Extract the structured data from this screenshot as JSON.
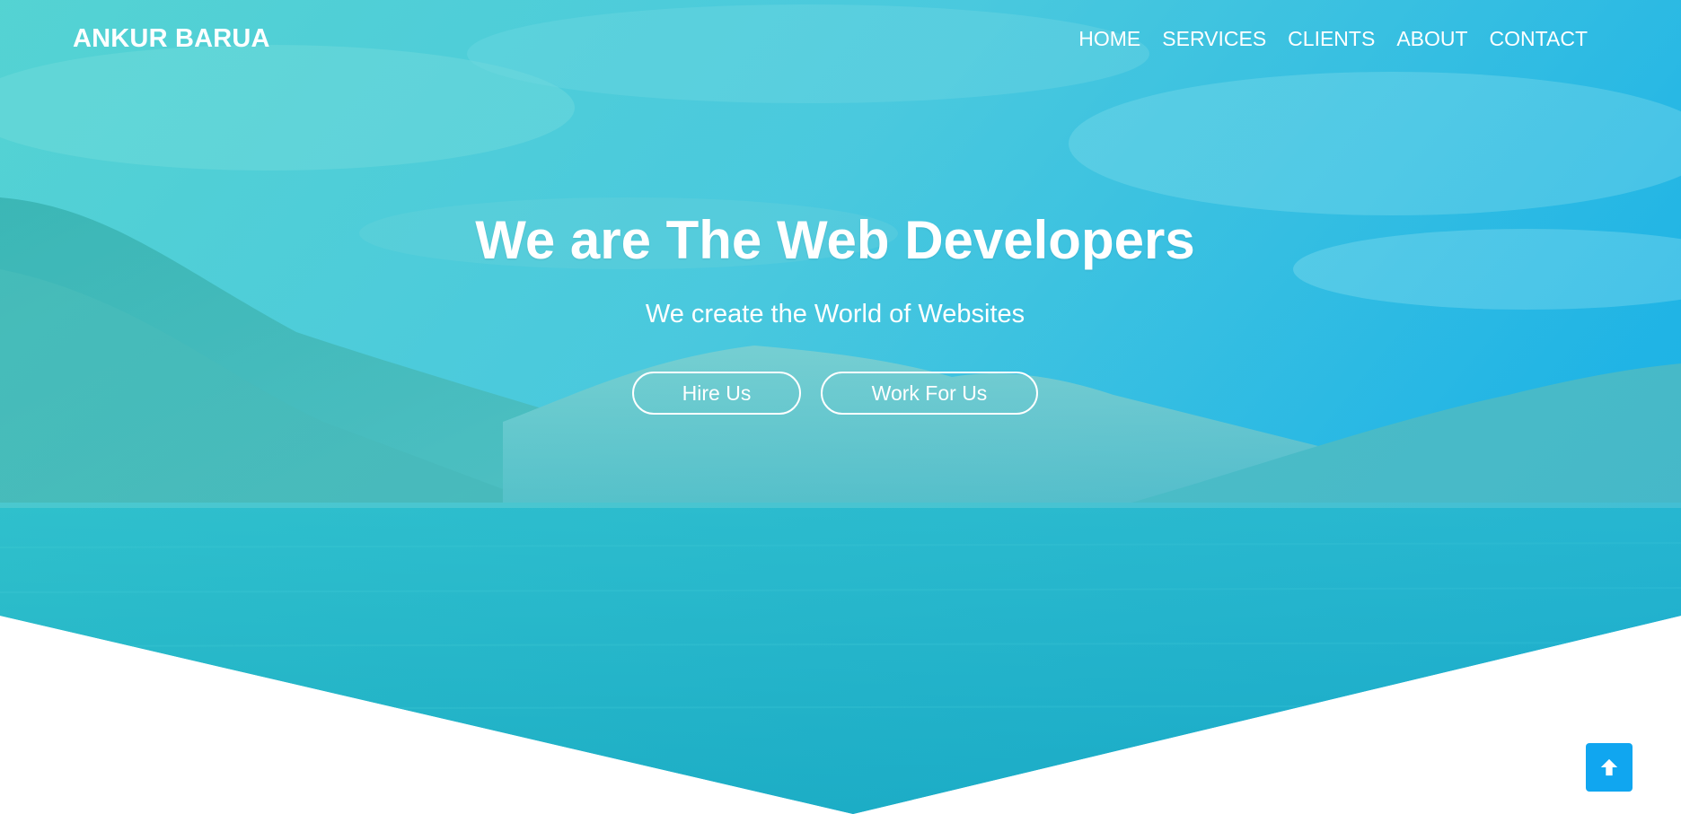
{
  "brand": {
    "name": "ANKUR BARUA"
  },
  "nav": {
    "items": [
      {
        "label": "HOME"
      },
      {
        "label": "SERVICES"
      },
      {
        "label": "CLIENTS"
      },
      {
        "label": "ABOUT"
      },
      {
        "label": "CONTACT"
      }
    ]
  },
  "hero": {
    "headline": "We are The Web Developers",
    "subheadline": "We create the World of Websites",
    "primary_button": "Hire Us",
    "secondary_button": "Work For Us",
    "overlay_color": "#3fc9d8",
    "background_subject": "mountain lake landscape"
  },
  "back_to_top": {
    "icon": "arrow-up-icon",
    "color": "#10a6f0"
  }
}
